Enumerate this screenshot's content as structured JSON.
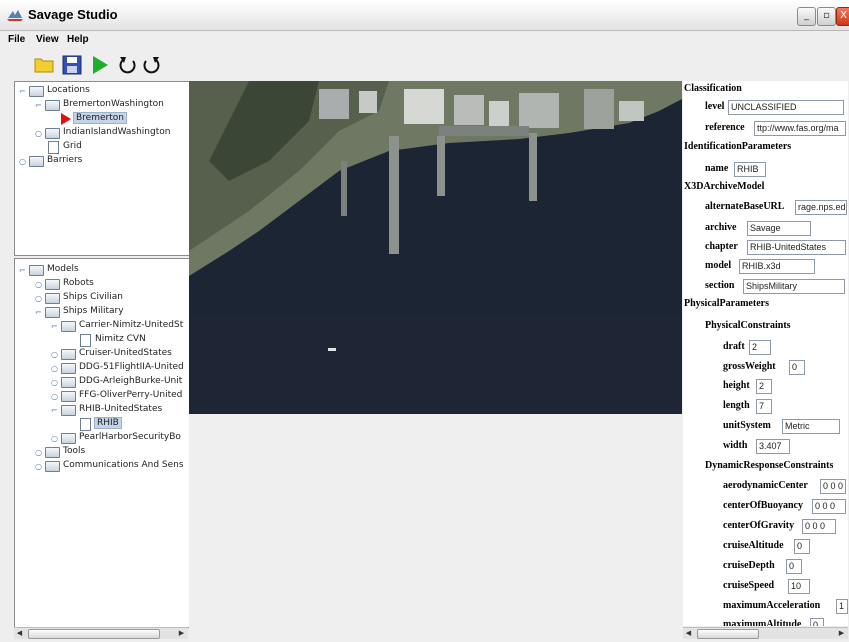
{
  "window": {
    "title": "Savage Studio",
    "buttons": {
      "minimize": "_",
      "maximize": "▫",
      "close": "X"
    }
  },
  "menu": {
    "file": "File",
    "view": "View",
    "help": "Help"
  },
  "toolbar": {
    "icons": [
      "open-folder-icon",
      "save-disk-icon",
      "play-icon",
      "undo-icon",
      "redo-icon"
    ]
  },
  "locations_tree": {
    "root": "Locations",
    "items": [
      "BremertonWashington",
      "Bremerton",
      "IndianIslandWashington",
      "Grid",
      "Barriers"
    ]
  },
  "models_tree": {
    "root": "Models",
    "items": [
      "Robots",
      "Ships Civilian",
      "Ships Military",
      "Carrier-Nimitz-UnitedSt",
      "Nimitz CVN",
      "Cruiser-UnitedStates",
      "DDG-51FlightIIA-United",
      "DDG-ArleighBurke-Unit",
      "FFG-OliverPerry-United",
      "RHIB-UnitedStates",
      "RHIB",
      "PearlHarborSecurityBo",
      "Tools",
      "Communications And Sens"
    ]
  },
  "map": {
    "water_color": "#1c2534",
    "land_color": "#6f7862",
    "marker": "RHIB-marker"
  },
  "properties": {
    "classification": "Classification",
    "level_label": "level",
    "level_value": "UNCLASSIFIED",
    "reference_label": "reference",
    "reference_value": "ttp://www.fas.org/ma",
    "identification": "IdentificationParameters",
    "name_label": "name",
    "name_value": "RHIB",
    "x3d": "X3DArchiveModel",
    "altbase_label": "alternateBaseURL",
    "altbase_value": "rage.nps.ed",
    "archive_label": "archive",
    "archive_value": "Savage",
    "chapter_label": "chapter",
    "chapter_value": "RHIB-UnitedStates",
    "model_label": "model",
    "model_value": "RHIB.x3d",
    "section_label": "section",
    "section_value": "ShipsMilitary",
    "physical": "PhysicalParameters",
    "constraints": "PhysicalConstraints",
    "draft_label": "draft",
    "draft_value": "2",
    "gross_label": "grossWeight",
    "gross_value": "0",
    "height_label": "height",
    "height_value": "2",
    "length_label": "length",
    "length_value": "7",
    "unit_label": "unitSystem",
    "unit_value": "Metric",
    "width_label": "width",
    "width_value": "3.407",
    "dynamic": "DynamicResponseConstraints",
    "aero_label": "aerodynamicCenter",
    "aero_value": "0 0 0",
    "buoy_label": "centerOfBuoyancy",
    "buoy_value": "0 0 0",
    "grav_label": "centerOfGravity",
    "grav_value": "0 0 0",
    "calt_label": "cruiseAltitude",
    "calt_value": "0",
    "cdep_label": "cruiseDepth",
    "cdep_value": "0",
    "cspd_label": "cruiseSpeed",
    "cspd_value": "10",
    "macc_label": "maximumAcceleration",
    "macc_value": "1",
    "malt_label": "maximumAltitude",
    "malt_value": "0"
  },
  "scrollbars": {
    "left": "||",
    "arrow_left": "◀",
    "arrow_right": "▶"
  }
}
